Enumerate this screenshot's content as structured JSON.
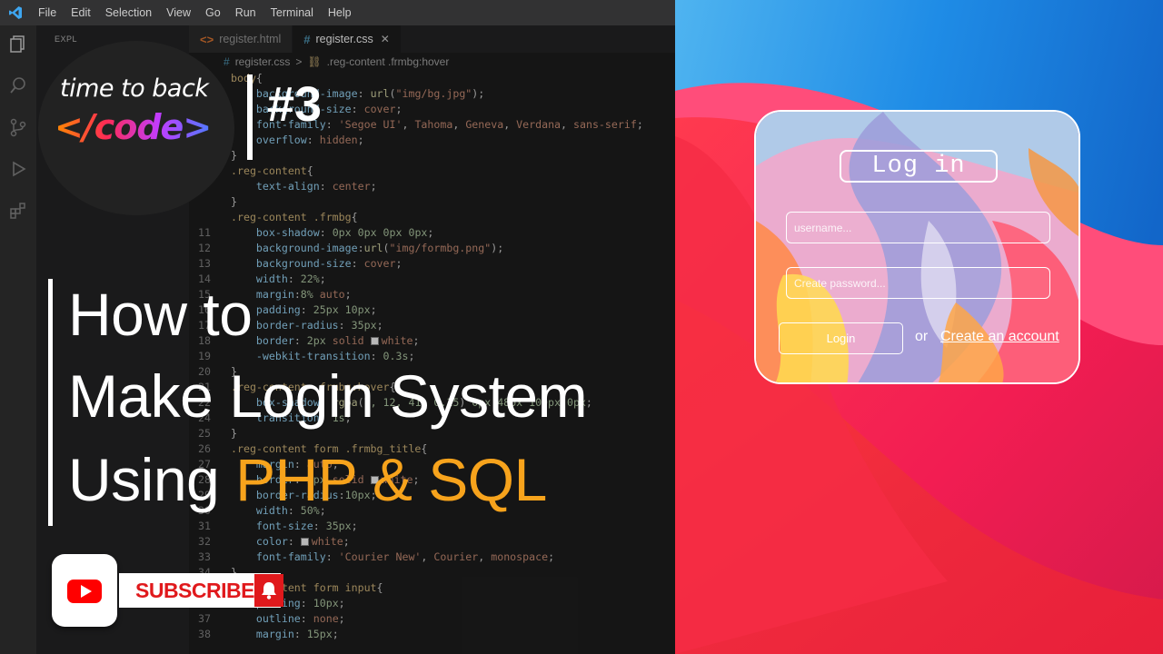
{
  "menubar": {
    "items": [
      "File",
      "Edit",
      "Selection",
      "View",
      "Go",
      "Run",
      "Terminal",
      "Help"
    ]
  },
  "explorer": {
    "title": "EXPL"
  },
  "tabs": [
    {
      "label": "register.html",
      "active": false
    },
    {
      "label": "register.css",
      "active": true
    }
  ],
  "breadcrumb": {
    "file": "register.css",
    "separator": ">",
    "symbol": ".reg-content .frmbg:hover"
  },
  "editor": {
    "lines": [
      {
        "n": "",
        "t": [
          [
            "sel",
            "body"
          ],
          [
            "pun",
            "{"
          ]
        ]
      },
      {
        "n": "",
        "t": [
          [
            "prop",
            "    background-image"
          ],
          [
            "pun",
            ": "
          ],
          [
            "fn",
            "url"
          ],
          [
            "pun",
            "("
          ],
          [
            "val",
            "\"img/bg.jpg\""
          ],
          [
            "pun",
            ");"
          ]
        ]
      },
      {
        "n": "",
        "t": [
          [
            "prop",
            "    background-size"
          ],
          [
            "pun",
            ": "
          ],
          [
            "val",
            "cover"
          ],
          [
            "pun",
            ";"
          ]
        ]
      },
      {
        "n": "",
        "t": [
          [
            "prop",
            "    font-family"
          ],
          [
            "pun",
            ": "
          ],
          [
            "val",
            "'Segoe UI'"
          ],
          [
            "pun",
            ", "
          ],
          [
            "val",
            "Tahoma"
          ],
          [
            "pun",
            ", "
          ],
          [
            "val",
            "Geneva"
          ],
          [
            "pun",
            ", "
          ],
          [
            "val",
            "Verdana"
          ],
          [
            "pun",
            ", "
          ],
          [
            "val",
            "sans-serif"
          ],
          [
            "pun",
            ";"
          ]
        ]
      },
      {
        "n": "",
        "t": [
          [
            "prop",
            "    overflow"
          ],
          [
            "pun",
            ": "
          ],
          [
            "val",
            "hidden"
          ],
          [
            "pun",
            ";"
          ]
        ]
      },
      {
        "n": "",
        "t": [
          [
            "pun",
            "}"
          ]
        ]
      },
      {
        "n": "",
        "t": [
          [
            "sel",
            ".reg-content"
          ],
          [
            "pun",
            "{"
          ]
        ]
      },
      {
        "n": "",
        "t": [
          [
            "prop",
            "    text-align"
          ],
          [
            "pun",
            ": "
          ],
          [
            "val",
            "center"
          ],
          [
            "pun",
            ";"
          ]
        ]
      },
      {
        "n": "",
        "t": [
          [
            "pun",
            "}"
          ]
        ]
      },
      {
        "n": "",
        "t": [
          [
            "sel",
            ".reg-content .frmbg"
          ],
          [
            "pun",
            "{"
          ]
        ]
      },
      {
        "n": "11",
        "t": [
          [
            "prop",
            "    box-shadow"
          ],
          [
            "pun",
            ": "
          ],
          [
            "num",
            "0px 0px 0px 0px"
          ],
          [
            "pun",
            ";"
          ]
        ]
      },
      {
        "n": "12",
        "t": [
          [
            "prop",
            "    background-image"
          ],
          [
            "pun",
            ":"
          ],
          [
            "fn",
            "url"
          ],
          [
            "pun",
            "("
          ],
          [
            "val",
            "\"img/formbg.png\""
          ],
          [
            "pun",
            ");"
          ]
        ]
      },
      {
        "n": "13",
        "t": [
          [
            "prop",
            "    background-size"
          ],
          [
            "pun",
            ": "
          ],
          [
            "val",
            "cover"
          ],
          [
            "pun",
            ";"
          ]
        ]
      },
      {
        "n": "14",
        "t": [
          [
            "prop",
            "    width"
          ],
          [
            "pun",
            ": "
          ],
          [
            "num",
            "22%"
          ],
          [
            "pun",
            ";"
          ]
        ]
      },
      {
        "n": "15",
        "t": [
          [
            "prop",
            "    margin"
          ],
          [
            "pun",
            ":"
          ],
          [
            "num",
            "8%"
          ],
          [
            "val",
            " auto"
          ],
          [
            "pun",
            ";"
          ]
        ]
      },
      {
        "n": "16",
        "t": [
          [
            "prop",
            "    padding"
          ],
          [
            "pun",
            ": "
          ],
          [
            "num",
            "25px 10px"
          ],
          [
            "pun",
            ";"
          ]
        ]
      },
      {
        "n": "17",
        "t": [
          [
            "prop",
            "    border-radius"
          ],
          [
            "pun",
            ": "
          ],
          [
            "num",
            "35px"
          ],
          [
            "pun",
            ";"
          ]
        ]
      },
      {
        "n": "18",
        "t": [
          [
            "prop",
            "    border"
          ],
          [
            "pun",
            ": "
          ],
          [
            "num",
            "2px"
          ],
          [
            "val",
            " solid "
          ],
          [
            "sw",
            ""
          ],
          [
            "val",
            "white"
          ],
          [
            "pun",
            ";"
          ]
        ]
      },
      {
        "n": "19",
        "t": [
          [
            "prop",
            "    -webkit-transition"
          ],
          [
            "pun",
            ": "
          ],
          [
            "num",
            "0.3s"
          ],
          [
            "pun",
            ";"
          ]
        ]
      },
      {
        "n": "20",
        "t": [
          [
            "pun",
            "}"
          ]
        ]
      },
      {
        "n": "21",
        "t": [
          [
            "sel",
            ".reg-content .frmbg:hover"
          ],
          [
            "pun",
            "{"
          ]
        ]
      },
      {
        "n": "22",
        "t": [
          [
            "prop",
            "    box-shadow"
          ],
          [
            "pun",
            ": "
          ],
          [
            "fn",
            "rgba"
          ],
          [
            "pun",
            "("
          ],
          [
            "num",
            "7, 12, 41, 0.15"
          ],
          [
            "pun",
            ") "
          ],
          [
            "num",
            "0px 48px 100px 0px"
          ],
          [
            "pun",
            ";"
          ]
        ]
      },
      {
        "n": "24",
        "t": [
          [
            "prop",
            "    transition"
          ],
          [
            "pun",
            ": "
          ],
          [
            "num",
            "1s"
          ],
          [
            "pun",
            ";"
          ]
        ]
      },
      {
        "n": "25",
        "t": [
          [
            "pun",
            "}"
          ]
        ]
      },
      {
        "n": "26",
        "t": [
          [
            "sel",
            ".reg-content form .frmbg_title"
          ],
          [
            "pun",
            "{"
          ]
        ]
      },
      {
        "n": "27",
        "t": [
          [
            "prop",
            "    margin"
          ],
          [
            "pun",
            ": "
          ],
          [
            "val",
            "auto"
          ],
          [
            "pun",
            ";"
          ]
        ]
      },
      {
        "n": "28",
        "t": [
          [
            "prop",
            "    border"
          ],
          [
            "pun",
            ": "
          ],
          [
            "num",
            "2px"
          ],
          [
            "val",
            " solid "
          ],
          [
            "sw",
            ""
          ],
          [
            "val",
            "white"
          ],
          [
            "pun",
            ";"
          ]
        ]
      },
      {
        "n": "29",
        "t": [
          [
            "prop",
            "    border-radius"
          ],
          [
            "pun",
            ":"
          ],
          [
            "num",
            "10px"
          ],
          [
            "pun",
            ";"
          ]
        ]
      },
      {
        "n": "30",
        "t": [
          [
            "prop",
            "    width"
          ],
          [
            "pun",
            ": "
          ],
          [
            "num",
            "50%"
          ],
          [
            "pun",
            ";"
          ]
        ]
      },
      {
        "n": "31",
        "t": [
          [
            "prop",
            "    font-size"
          ],
          [
            "pun",
            ": "
          ],
          [
            "num",
            "35px"
          ],
          [
            "pun",
            ";"
          ]
        ]
      },
      {
        "n": "32",
        "t": [
          [
            "prop",
            "    color"
          ],
          [
            "pun",
            ": "
          ],
          [
            "sw",
            ""
          ],
          [
            "val",
            "white"
          ],
          [
            "pun",
            ";"
          ]
        ]
      },
      {
        "n": "33",
        "t": [
          [
            "prop",
            "    font-family"
          ],
          [
            "pun",
            ": "
          ],
          [
            "val",
            "'Courier New'"
          ],
          [
            "pun",
            ", "
          ],
          [
            "val",
            "Courier"
          ],
          [
            "pun",
            ", "
          ],
          [
            "val",
            "monospace"
          ],
          [
            "pun",
            ";"
          ]
        ]
      },
      {
        "n": "34",
        "t": [
          [
            "pun",
            "}"
          ]
        ]
      },
      {
        "n": "35",
        "t": [
          [
            "sel",
            ".reg-content form input"
          ],
          [
            "pun",
            "{"
          ]
        ]
      },
      {
        "n": "36",
        "t": [
          [
            "prop",
            "    padding"
          ],
          [
            "pun",
            ": "
          ],
          [
            "num",
            "10px"
          ],
          [
            "pun",
            ";"
          ]
        ]
      },
      {
        "n": "37",
        "t": [
          [
            "prop",
            "    outline"
          ],
          [
            "pun",
            ": "
          ],
          [
            "val",
            "none"
          ],
          [
            "pun",
            ";"
          ]
        ]
      },
      {
        "n": "38",
        "t": [
          [
            "prop",
            "    margin"
          ],
          [
            "pun",
            ": "
          ],
          [
            "num",
            "15px"
          ],
          [
            "pun",
            ";"
          ]
        ]
      }
    ]
  },
  "overlay": {
    "brand_top": "time to back",
    "brand_bottom": "</code>",
    "episode": "#3",
    "title_line1": "How to",
    "title_line2": "Make Login System",
    "title_line3_plain": "Using ",
    "title_line3_accent": "PHP & SQL",
    "subscribe": "SUBSCRIBE",
    "accent_color": "#f7a31c"
  },
  "login": {
    "title": "Log in",
    "username_placeholder": "username...",
    "password_placeholder": "Create password...",
    "button": "Login",
    "or": "or",
    "create_link": "Create an account"
  }
}
